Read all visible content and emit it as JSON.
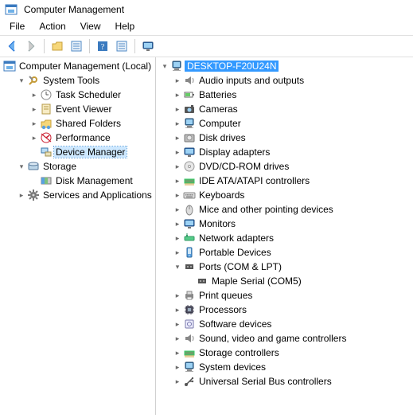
{
  "window": {
    "title": "Computer Management"
  },
  "menu": {
    "file": "File",
    "action": "Action",
    "view": "View",
    "help": "Help"
  },
  "left_tree": {
    "root": "Computer Management (Local)",
    "system_tools": {
      "label": "System Tools",
      "task_scheduler": "Task Scheduler",
      "event_viewer": "Event Viewer",
      "shared_folders": "Shared Folders",
      "performance": "Performance",
      "device_manager": "Device Manager"
    },
    "storage": {
      "label": "Storage",
      "disk_management": "Disk Management"
    },
    "services_apps": "Services and Applications"
  },
  "right_tree": {
    "host": "DESKTOP-F20U24N",
    "audio": "Audio inputs and outputs",
    "batteries": "Batteries",
    "cameras": "Cameras",
    "computer": "Computer",
    "disk_drives": "Disk drives",
    "display": "Display adapters",
    "dvd": "DVD/CD-ROM drives",
    "ide": "IDE ATA/ATAPI controllers",
    "keyboards": "Keyboards",
    "mice": "Mice and other pointing devices",
    "monitors": "Monitors",
    "network": "Network adapters",
    "portable": "Portable Devices",
    "ports": {
      "label": "Ports (COM & LPT)",
      "maple": "Maple Serial (COM5)"
    },
    "printq": "Print queues",
    "processors": "Processors",
    "software": "Software devices",
    "sound": "Sound, video and game controllers",
    "storagec": "Storage controllers",
    "system": "System devices",
    "usb": "Universal Serial Bus controllers"
  }
}
